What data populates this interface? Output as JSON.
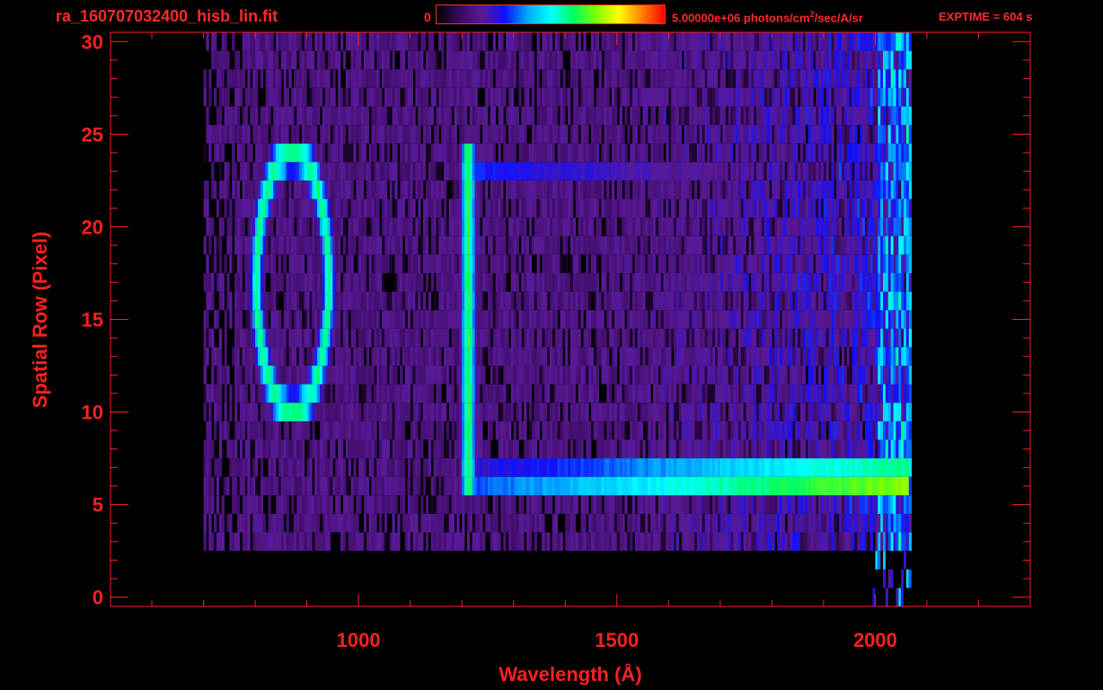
{
  "header": {
    "filename": "ra_160707032400_hisb_lin.fit",
    "colorbar_min": "0",
    "colorbar_max": "5.00000e+06",
    "units_pre": "photons/cm",
    "units_sup": "2",
    "units_post": "/sec/A/sr",
    "exptime": "EXPTIME = 604 s"
  },
  "colors": {
    "axis": "#ff2020",
    "background": "#000000",
    "colormap": [
      "#000000",
      "#3a0a5e",
      "#5a1a96",
      "#1010ff",
      "#00aaff",
      "#00ffff",
      "#00ff60",
      "#80ff00",
      "#ffff00",
      "#ff8000",
      "#ff0000"
    ]
  },
  "chart_data": {
    "type": "heatmap",
    "xlabel": "Wavelength (Å)",
    "ylabel": "Spatial Row (Pixel)",
    "xlim": [
      520,
      2300
    ],
    "ylim": [
      -0.5,
      30.5
    ],
    "xticks": [
      1000,
      1500,
      2000
    ],
    "xtick_labels": [
      "1000",
      "1500",
      "2000"
    ],
    "yticks": [
      0,
      5,
      10,
      15,
      20,
      25,
      30
    ],
    "ytick_labels": [
      "0",
      "5",
      "10",
      "15",
      "20",
      "25",
      "30"
    ],
    "x_minor_step": 100,
    "y_minor_step": 1,
    "colorbar_range": [
      0,
      5000000
    ],
    "data_extent": {
      "x": [
        700,
        2070
      ],
      "rows": [
        3,
        30
      ]
    },
    "features": [
      {
        "kind": "loop",
        "center_x": 870,
        "center_row": 17,
        "half_width_x": 70,
        "half_height_rows": 7,
        "peak": 0.55
      },
      {
        "kind": "vertical_band",
        "x": 1210,
        "rows": [
          6,
          24
        ],
        "peak": 0.6
      },
      {
        "kind": "horizontal_band",
        "row": 6,
        "x": [
          1200,
          2060
        ],
        "peak_start": 0.3,
        "peak_end": 0.68
      },
      {
        "kind": "horizontal_band",
        "row": 7,
        "x": [
          1200,
          2060
        ],
        "peak_start": 0.22,
        "peak_end": 0.55
      },
      {
        "kind": "horizontal_band",
        "row": 23,
        "x": [
          1220,
          1700
        ],
        "peak_start": 0.28,
        "peak_end": 0.15
      }
    ]
  }
}
